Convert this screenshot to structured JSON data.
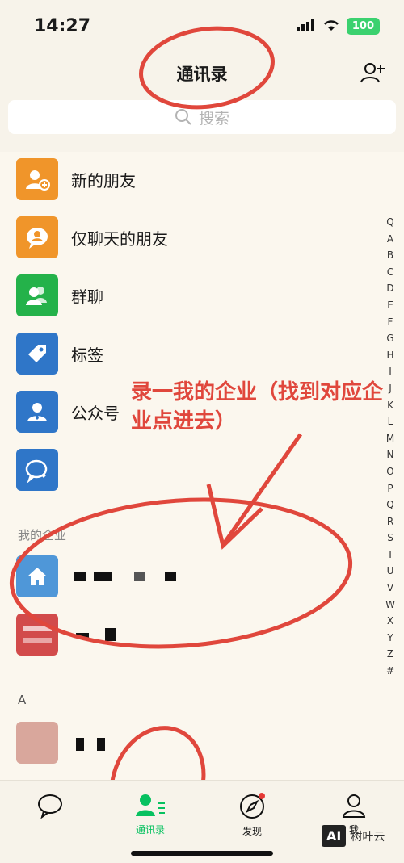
{
  "status": {
    "time": "14:27",
    "battery": "100"
  },
  "header": {
    "title": "通讯录"
  },
  "search": {
    "placeholder": "搜索"
  },
  "menu": [
    {
      "label": "新的朋友",
      "color": "#f0952a",
      "icon": "add-friend-icon"
    },
    {
      "label": "仅聊天的朋友",
      "color": "#f0952a",
      "icon": "chat-only-icon"
    },
    {
      "label": "群聊",
      "color": "#24b24a",
      "icon": "group-chat-icon"
    },
    {
      "label": "标签",
      "color": "#2f76c8",
      "icon": "tag-icon"
    },
    {
      "label": "公众号",
      "color": "#2f76c8",
      "icon": "official-account-icon"
    },
    {
      "label": "",
      "color": "#2f76c8",
      "icon": "service-chat-icon"
    }
  ],
  "enterprise": {
    "section_title": "我的企业"
  },
  "contacts": {
    "section_title": "A"
  },
  "index": [
    "Q",
    "A",
    "B",
    "C",
    "D",
    "E",
    "F",
    "G",
    "H",
    "I",
    "J",
    "K",
    "L",
    "M",
    "N",
    "O",
    "P",
    "Q",
    "R",
    "S",
    "T",
    "U",
    "V",
    "W",
    "X",
    "Y",
    "Z",
    "#"
  ],
  "annotation": "录一我的企业（找到对应企业点进去）",
  "tabs": [
    {
      "label": "",
      "active": false
    },
    {
      "label": "通讯录",
      "active": true
    },
    {
      "label": "发现",
      "active": false
    },
    {
      "label": "我",
      "active": false
    }
  ],
  "watermark": {
    "badge": "AI",
    "text": "树叶云"
  },
  "colors": {
    "accent": "#07c160",
    "annotation": "#e0473c"
  }
}
